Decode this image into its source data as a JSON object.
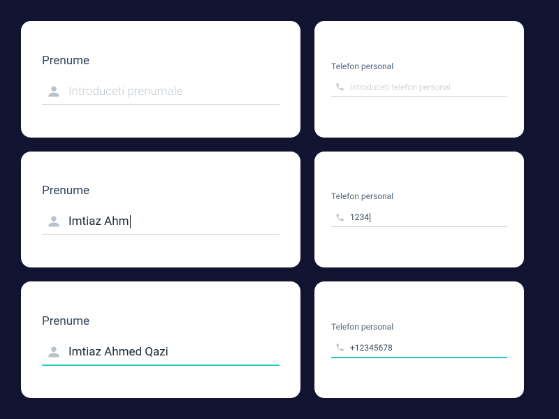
{
  "left": {
    "label": "Prenume",
    "placeholder": "Introduceti prenumale",
    "partial": "Imtiaz Ahm",
    "full": "Imtiaz Ahmed Qazi"
  },
  "right": {
    "label": "Telefon personal",
    "placeholder": "Introduceti telefon personal",
    "partial": "1234",
    "full": "+12345678"
  },
  "colors": {
    "icon": "#b9c2cb",
    "accent": "#1cccc0"
  }
}
